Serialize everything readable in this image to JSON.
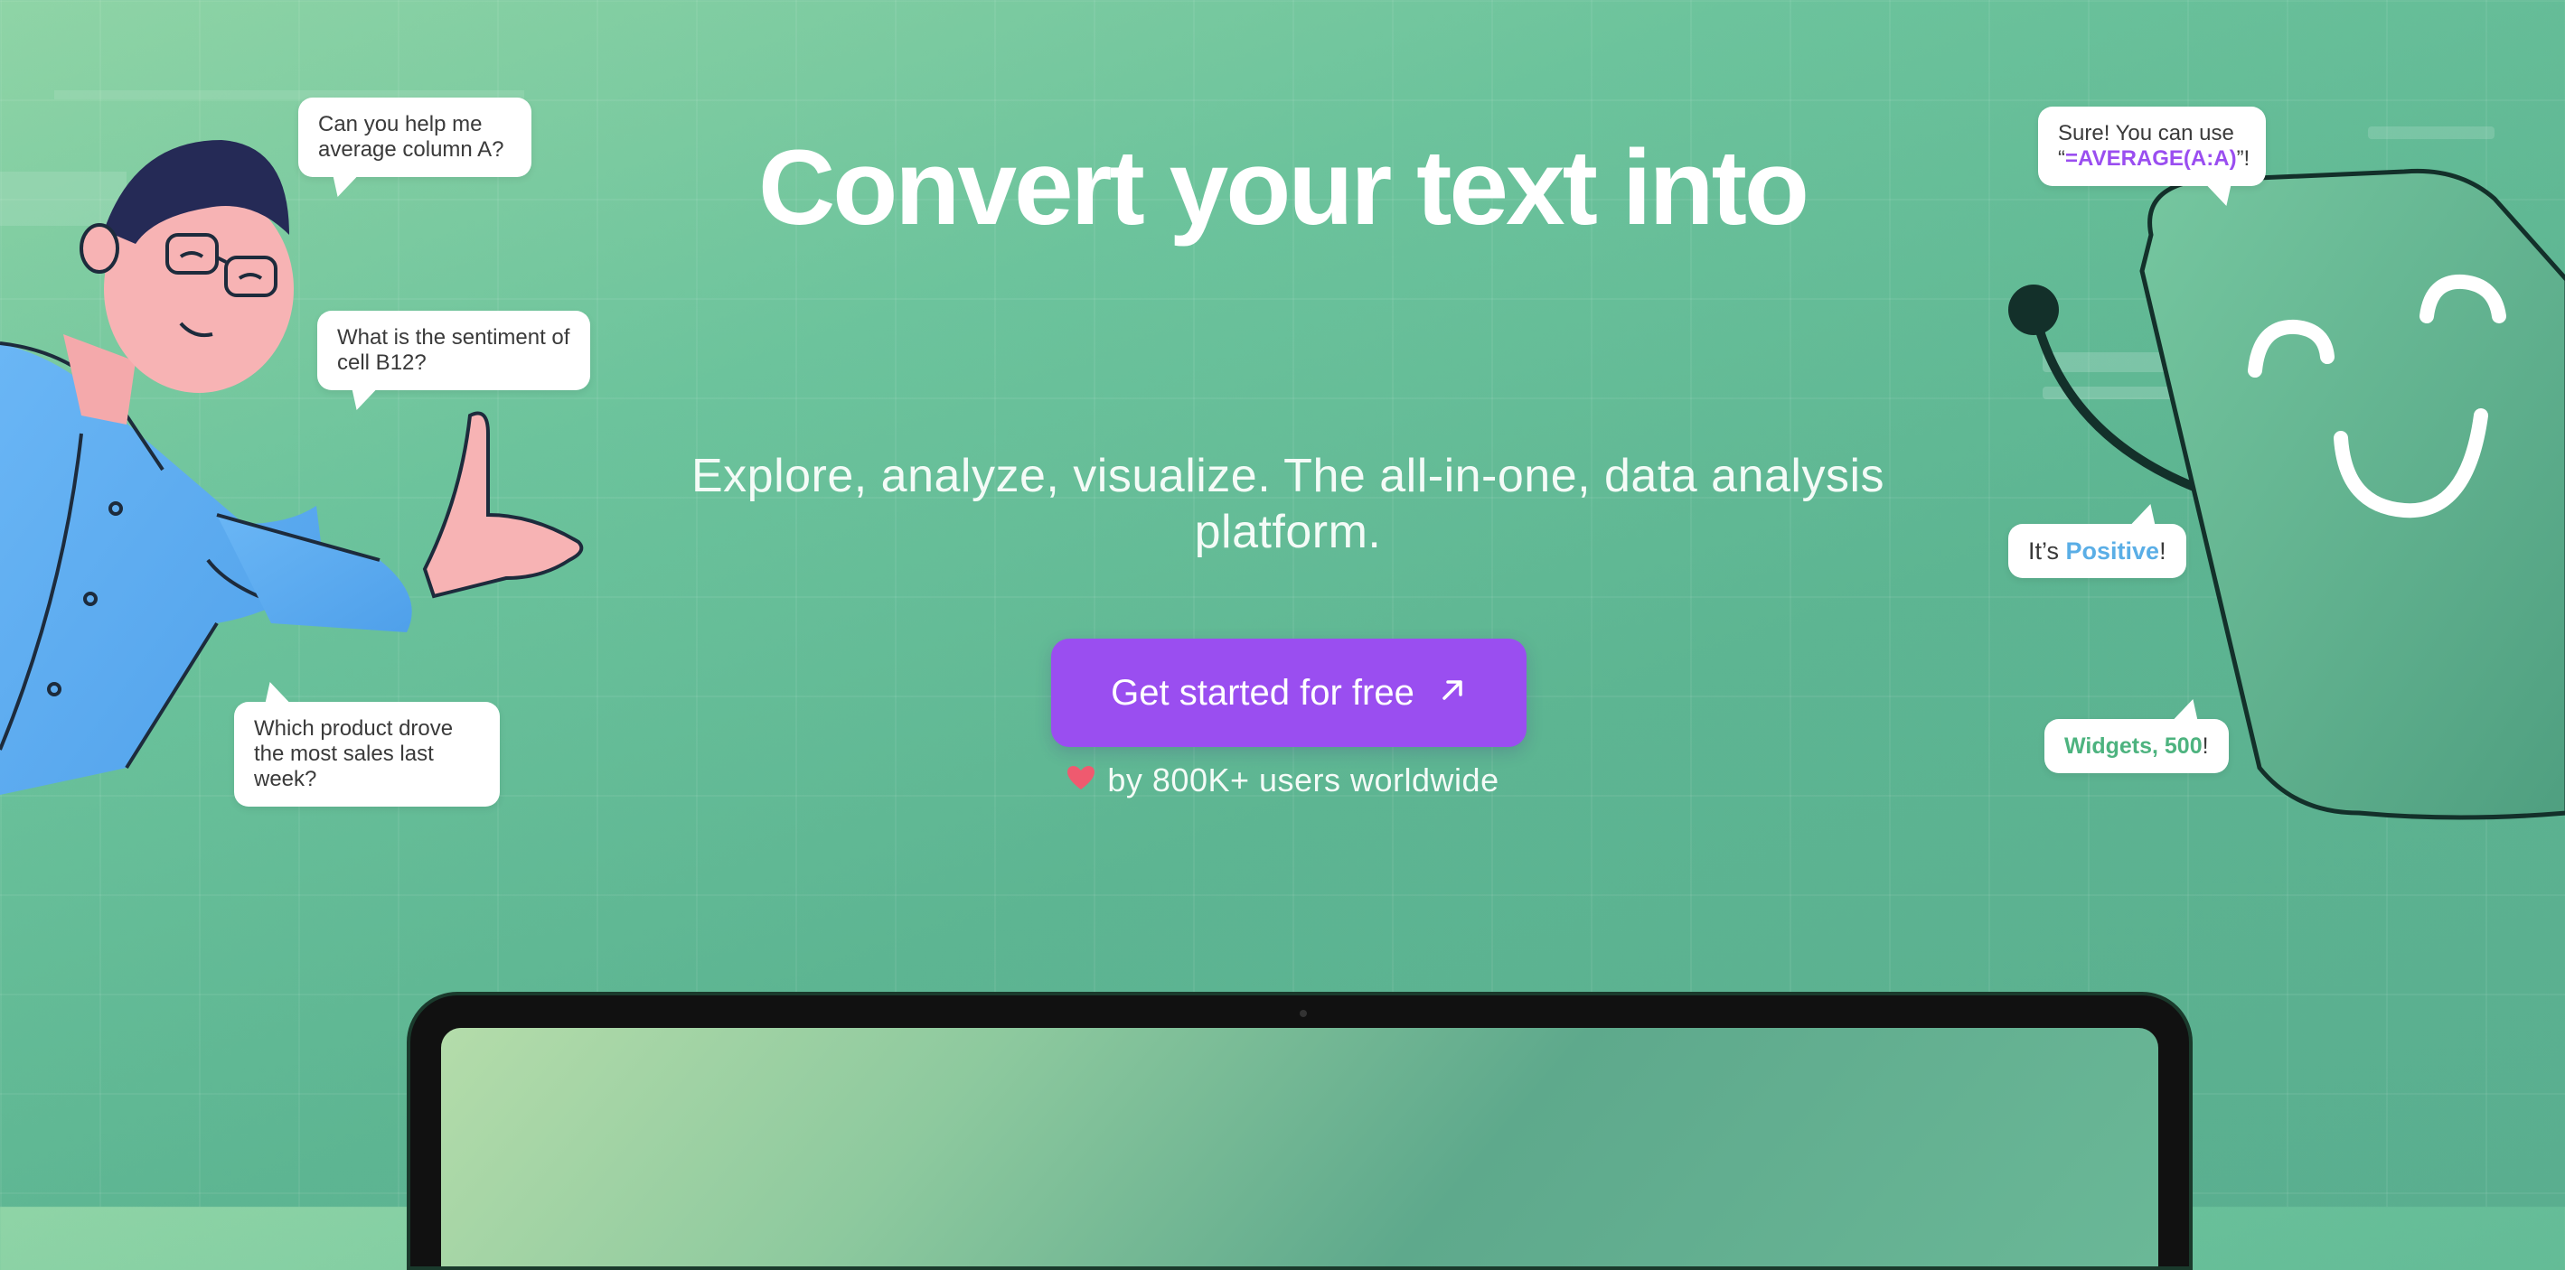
{
  "hero": {
    "headline": "Convert your text into",
    "subheadline": "Explore, analyze, visualize. The all-in-one, data analysis platform.",
    "cta_label": "Get started for free",
    "cta_icon": "arrow-up-right-icon",
    "social_proof": "by 800K+ users worldwide",
    "social_proof_icon": "heart-icon"
  },
  "left_bubbles": {
    "b1": "Can you help me average column A?",
    "b2": "What is the sentiment of cell B12?",
    "b3": "Which product drove the most sales last week?"
  },
  "right_bubbles": {
    "b1_prefix": "Sure! You can use",
    "b1_formula_open": "“",
    "b1_formula": "=AVERAGE(A:A)",
    "b1_formula_close": "”!",
    "b2_prefix": "It’s ",
    "b2_highlight": "Positive",
    "b2_suffix": "!",
    "b3_highlight": "Widgets, 500",
    "b3_suffix": "!"
  },
  "colors": {
    "accent": "#9a4ef0",
    "positive": "#5aaee6",
    "widgets": "#4db37f",
    "background": "#6cc39c"
  }
}
